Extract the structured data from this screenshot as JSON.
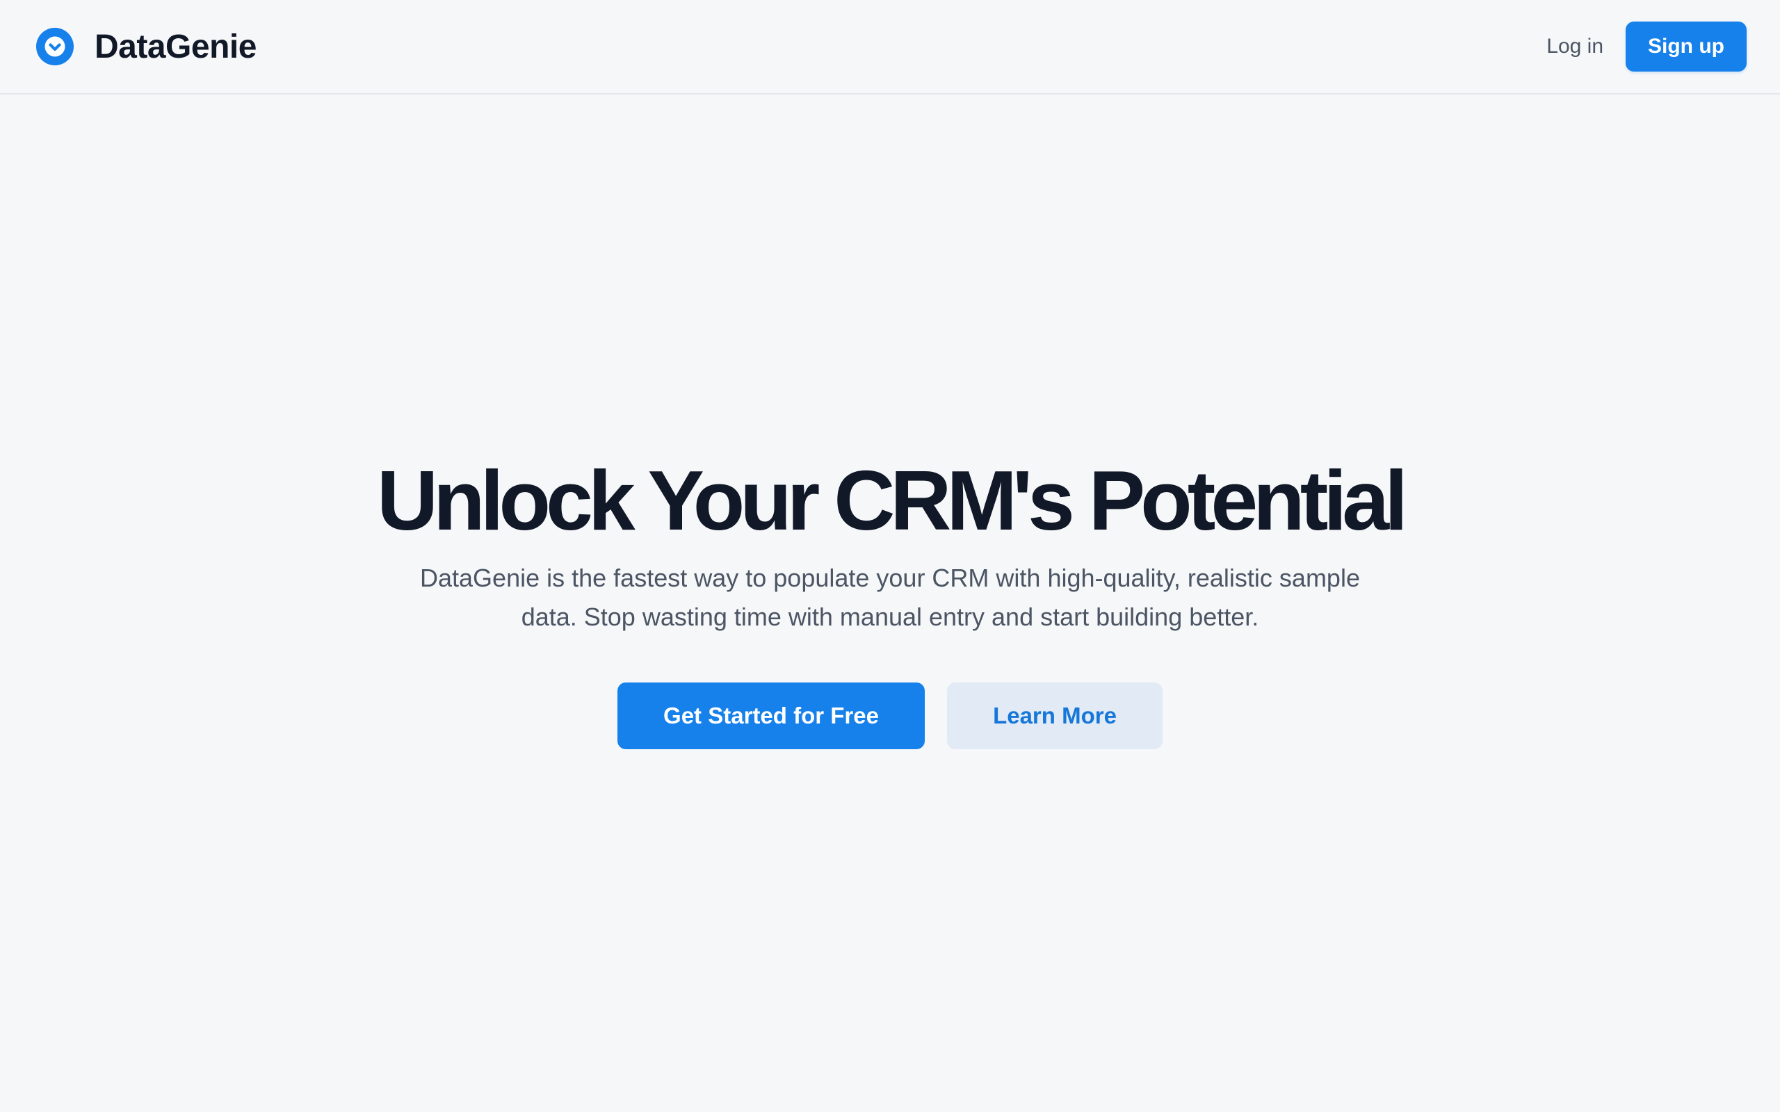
{
  "header": {
    "brand_name": "DataGenie",
    "logo_icon": "chevron-down-circle-icon",
    "login_label": "Log in",
    "signup_label": "Sign up"
  },
  "hero": {
    "title": "Unlock Your CRM's Potential",
    "subtitle": "DataGenie is the fastest way to populate your CRM with high-quality, realistic sample data. Stop wasting time with manual entry and start building better.",
    "primary_cta": "Get Started for Free",
    "secondary_cta": "Learn More"
  },
  "colors": {
    "accent": "#1680eb",
    "background": "#f6f7f9",
    "heading": "#111827",
    "body_text": "#4b5563",
    "secondary_button_bg": "#e1eaf5"
  }
}
